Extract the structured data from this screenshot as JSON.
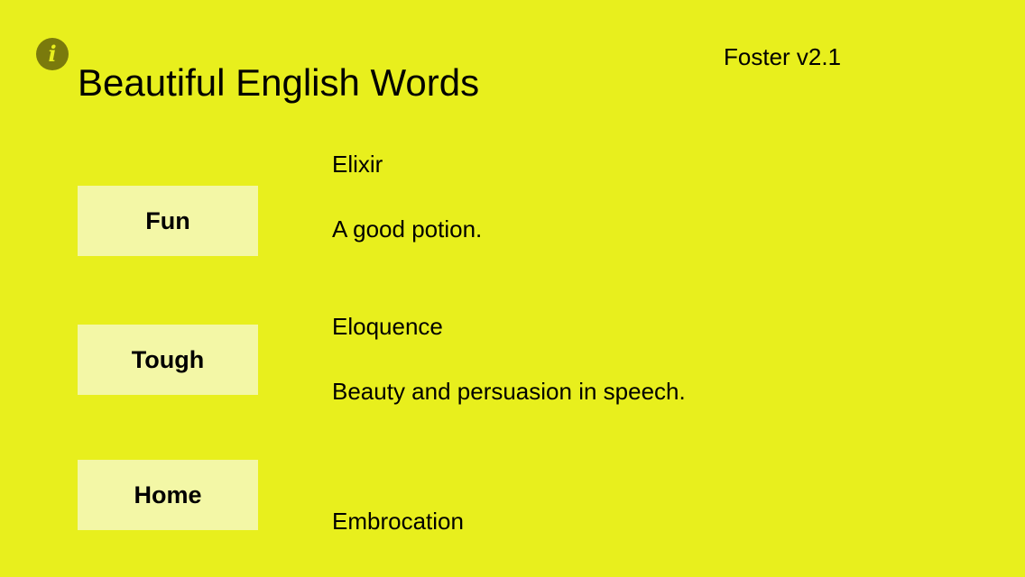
{
  "header": {
    "info_icon": "info-icon",
    "info_glyph": "i",
    "title": "Beautiful English Words",
    "version": "Foster v2.1"
  },
  "nav": {
    "fun_label": "Fun",
    "tough_label": "Tough",
    "home_label": "Home"
  },
  "words": [
    {
      "word": "Elixir",
      "definition": "A good potion."
    },
    {
      "word": "Eloquence",
      "definition": "Beauty and persuasion in speech."
    },
    {
      "word": "Embrocation"
    }
  ],
  "colors": {
    "background": "#e8ef1d",
    "button_fill": "#f3f7a6",
    "info_icon": "#7a7a0c",
    "text": "#000000"
  }
}
